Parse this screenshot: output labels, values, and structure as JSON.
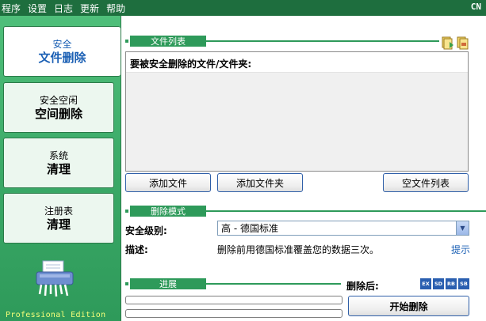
{
  "menu": {
    "items": [
      "程序",
      "设置",
      "日志",
      "更新",
      "帮助"
    ],
    "right_label": "CN"
  },
  "sidebar": {
    "items": [
      {
        "small": "安全",
        "big": "文件删除",
        "active": true
      },
      {
        "small": "安全空闲",
        "big": "空间删除",
        "active": false
      },
      {
        "small": "系统",
        "big": "清理",
        "active": false
      },
      {
        "small": "注册表",
        "big": "清理",
        "active": false
      }
    ],
    "edition": "Professional Edition",
    "logo_icon": "shredder-icon"
  },
  "file_section": {
    "title": "文件列表",
    "list_header": "要被安全删除的文件/文件夹:",
    "add_file": "添加文件",
    "add_folder": "添加文件夹",
    "clear_list": "空文件列表",
    "icons": [
      "add-file-icon",
      "add-folder-icon"
    ]
  },
  "mode_section": {
    "title": "删除模式",
    "level_label": "安全级别:",
    "level_value": "高 - 德国标准",
    "desc_label": "描述:",
    "desc_text": "删除前用德国标准覆盖您的数据三次。",
    "hint": "提示"
  },
  "progress_section": {
    "title": "进展",
    "after_label": "删除后:",
    "badges": [
      "EX",
      "SD",
      "RB",
      "SB"
    ],
    "start_button": "开始删除",
    "progress_1": 0,
    "progress_2": 0
  },
  "colors": {
    "menubar": "#1e6e3e",
    "section_green": "#2e9a5a",
    "sidebar_green": "#3aa866",
    "active_text": "#1a5fb4",
    "badge_blue": "#2a5fb0",
    "edition_text": "#f5ff7a"
  }
}
